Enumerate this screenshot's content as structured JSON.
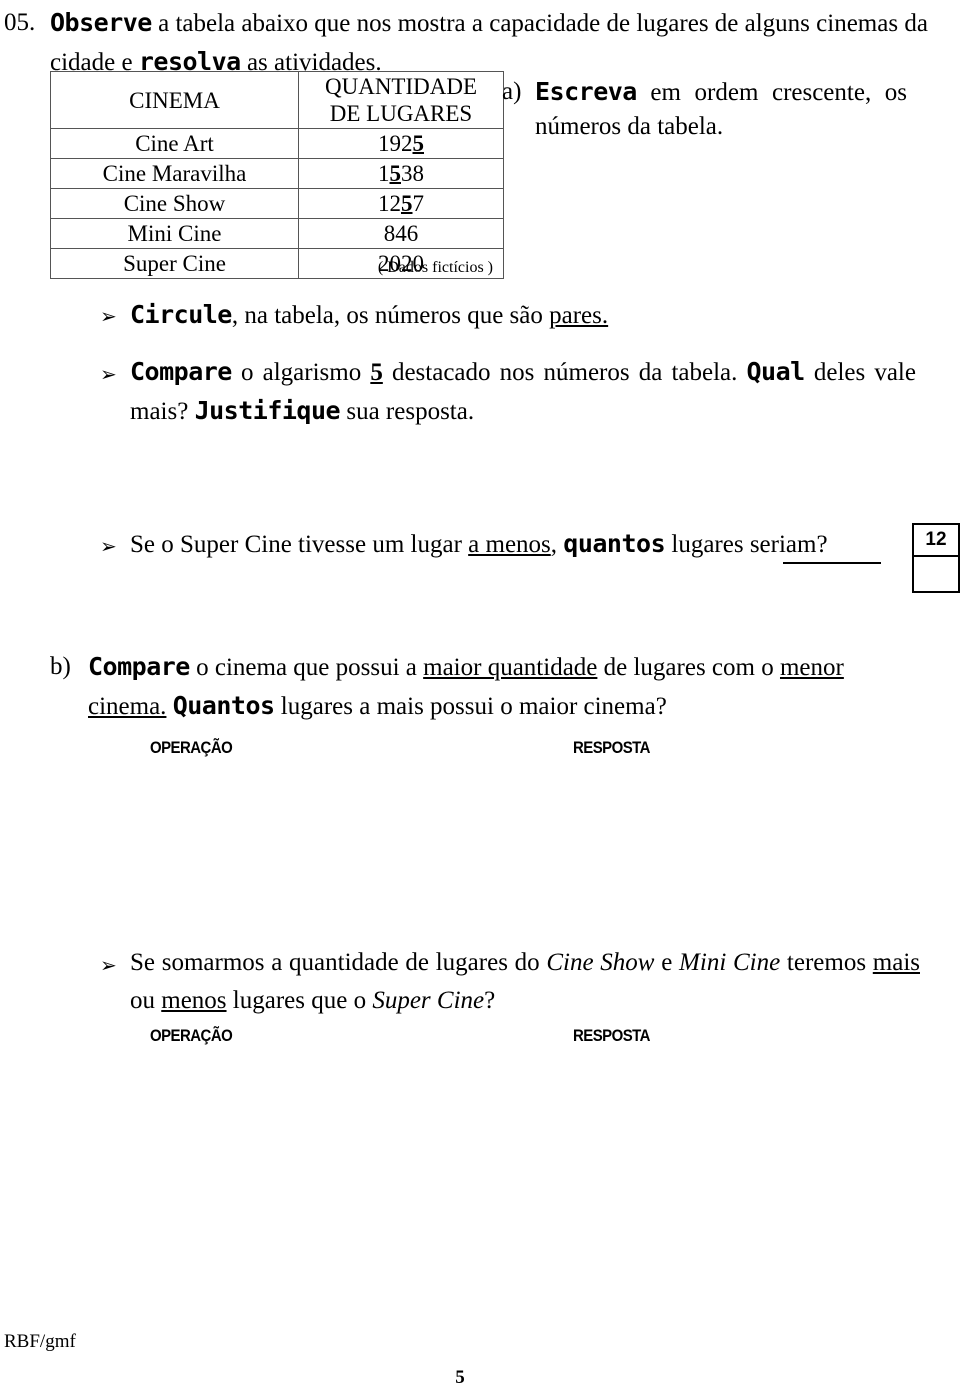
{
  "question": {
    "number": "05.",
    "prompt_bold_1": "Observe",
    "prompt_mid_1": " a tabela abaixo que nos mostra a capacidade de lugares de alguns cinemas da cidade e ",
    "prompt_bold_2": "resolva",
    "prompt_end": " as atividades."
  },
  "table": {
    "headers": [
      "CINEMA",
      "QUANTIDADE DE LUGARES"
    ],
    "header_line1": "QUANTIDADE",
    "header_line2": "DE LUGARES",
    "rows": [
      {
        "cinema": "Cine Art",
        "quantidade": "1925",
        "highlight_digit": "5",
        "highlight_index": 3
      },
      {
        "cinema": "Cine Maravilha",
        "quantidade": "1538",
        "highlight_digit": "5",
        "highlight_index": 1
      },
      {
        "cinema": "Cine Show",
        "quantidade": "1257",
        "highlight_digit": "5",
        "highlight_index": 2
      },
      {
        "cinema": "Mini Cine",
        "quantidade": "846",
        "highlight_digit": "",
        "highlight_index": -1
      },
      {
        "cinema": "Super Cine",
        "quantidade": "2020",
        "highlight_digit": "",
        "highlight_index": -1
      }
    ],
    "caption": "( Dados fictícios )"
  },
  "item_a": {
    "label": "a)",
    "bold_word": "Escreva",
    "rest": " em ordem crescente, os números da tabela."
  },
  "bullets": {
    "b1": {
      "marker": "➢",
      "bold_word": "Circule",
      "mid": ", na tabela, os números que são ",
      "underlined": "pares.",
      "tail": ""
    },
    "b2": {
      "marker": "➢",
      "bold_word": "Compare",
      "mid1": " o algarismo ",
      "underlined_digit": "5",
      "mid2": " destacado nos números da tabela. ",
      "bold_word_2": "Qual",
      "mid3": " deles vale mais? ",
      "bold_word_3": "Justifique",
      "tail": " sua resposta."
    },
    "b3": {
      "marker": "➢",
      "start": "Se o Super Cine tivesse um lugar ",
      "underlined": "a menos",
      "mid": ", ",
      "bold_word": "quantos",
      "tail": " lugares seriam?"
    },
    "b4": {
      "marker": "➢",
      "start": "Se somarmos a quantidade de lugares do ",
      "italic_1": "Cine Show",
      "mid1": " e ",
      "italic_2": "Mini Cine",
      "mid2": " teremos ",
      "underlined_1": "mais",
      "mid3": " ou ",
      "underlined_2": "menos",
      "mid4": " lugares que o ",
      "italic_3": "Super Cine",
      "tail": "?"
    }
  },
  "score_box": {
    "value": "12",
    "empty_value": ""
  },
  "item_b": {
    "label": "b)",
    "bold_word": "Compare",
    "mid1": " o cinema que possui a ",
    "underlined_1": "maior quantidade",
    "mid2": " de lugares com o ",
    "underlined_2": "menor cinema.",
    "bold_word_2": "Quantos",
    "tail": " lugares a mais possui o maior cinema?"
  },
  "work_labels": {
    "operacao": "OPERAÇÃO",
    "resposta": "RESPOSTA"
  },
  "footer": {
    "code": "RBF/gmf",
    "page_number": "5"
  },
  "colors": {
    "text": "#000000",
    "table_border": "#555555",
    "background": "#ffffff"
  }
}
